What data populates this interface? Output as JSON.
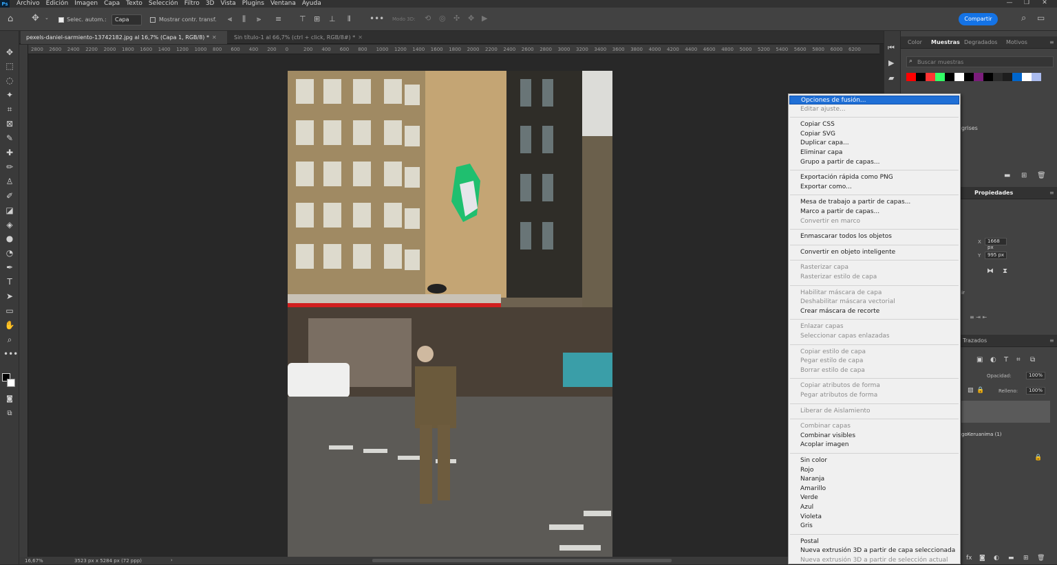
{
  "menubar": {
    "items": [
      "Archivo",
      "Edición",
      "Imagen",
      "Capa",
      "Texto",
      "Selección",
      "Filtro",
      "3D",
      "Vista",
      "Plugins",
      "Ventana",
      "Ayuda"
    ]
  },
  "options": {
    "auto_select_label": "Selec. autom.:",
    "layer_select": "Capa",
    "show_transform": "Mostrar contr. transf.",
    "mode3d": "Modo 3D:",
    "share": "Compartir"
  },
  "tabs": [
    {
      "label": "pexels-daniel-sarmiento-13742182.jpg al 16,7% (Capa 1, RGB/8) *"
    },
    {
      "label": "Sin título-1 al 66,7% (ctrl + click, RGB/8#) *"
    }
  ],
  "ruler_labels": [
    "2800",
    "2600",
    "2400",
    "2200",
    "2000",
    "1800",
    "1600",
    "1400",
    "1200",
    "1000",
    "800",
    "600",
    "400",
    "200",
    "0",
    "200",
    "400",
    "600",
    "800",
    "1000",
    "1200",
    "1400",
    "1600",
    "1800",
    "2000",
    "2200",
    "2400",
    "2600",
    "2800",
    "3000",
    "3200",
    "3400",
    "3600",
    "3800",
    "4000",
    "4200",
    "4400",
    "4600",
    "4800",
    "5000",
    "5200",
    "5400",
    "5600",
    "5800",
    "6000",
    "6200"
  ],
  "status": {
    "zoom": "16,67%",
    "dims": "3523 px x 5284 px (72 ppp)"
  },
  "panel": {
    "tabs": [
      "Color",
      "Muestras",
      "Degradados",
      "Motivos"
    ],
    "search_placeholder": "Buscar muestras",
    "swatch_colors": [
      "#ff0000",
      "#000000",
      "#ff3333",
      "#33ff66",
      "#000000",
      "#ffffff",
      "#000000",
      "#7b1d7b",
      "#000000",
      "#2b2b2b",
      "#1e1e1e",
      "#0066cc",
      "#ffffff",
      "#aabbee"
    ],
    "grises": "grises",
    "props_tab": "Propiedades",
    "x_label": "X",
    "x_value": "1668 px",
    "y_label": "Y",
    "y_value": "995 px",
    "ir": "ir",
    "trazados": "Trazados",
    "opacity_label": "Opacidad:",
    "opacity_value": "100%",
    "fill_label": "Relleno:",
    "fill_value": "100%",
    "layer_name": "goKeruanima (1)"
  },
  "context_menu": {
    "items": [
      {
        "label": "Opciones de fusión...",
        "state": "highlighted"
      },
      {
        "label": "Editar ajuste...",
        "state": "disabled"
      },
      {
        "label": "Copiar CSS",
        "state": "enabled"
      },
      {
        "label": "Copiar SVG",
        "state": "enabled"
      },
      {
        "label": "Duplicar capa...",
        "state": "enabled"
      },
      {
        "label": "Eliminar capa",
        "state": "enabled"
      },
      {
        "label": "Grupo a partir de capas...",
        "state": "enabled"
      },
      {
        "label": "Exportación rápida como PNG",
        "state": "enabled"
      },
      {
        "label": "Exportar como...",
        "state": "enabled"
      },
      {
        "label": "Mesa de trabajo a partir de capas...",
        "state": "enabled"
      },
      {
        "label": "Marco a partir de capas...",
        "state": "enabled"
      },
      {
        "label": "Convertir en marco",
        "state": "disabled"
      },
      {
        "label": "Enmascarar todos los objetos",
        "state": "enabled"
      },
      {
        "label": "Convertir en objeto inteligente",
        "state": "enabled"
      },
      {
        "label": "Rasterizar capa",
        "state": "disabled"
      },
      {
        "label": "Rasterizar estilo de capa",
        "state": "disabled"
      },
      {
        "label": "Habilitar máscara de capa",
        "state": "disabled"
      },
      {
        "label": "Deshabilitar máscara vectorial",
        "state": "disabled"
      },
      {
        "label": "Crear máscara de recorte",
        "state": "enabled"
      },
      {
        "label": "Enlazar capas",
        "state": "disabled"
      },
      {
        "label": "Seleccionar capas enlazadas",
        "state": "disabled"
      },
      {
        "label": "Copiar estilo de capa",
        "state": "disabled"
      },
      {
        "label": "Pegar estilo de capa",
        "state": "disabled"
      },
      {
        "label": "Borrar estilo de capa",
        "state": "disabled"
      },
      {
        "label": "Copiar atributos de forma",
        "state": "disabled"
      },
      {
        "label": "Pegar atributos de forma",
        "state": "disabled"
      },
      {
        "label": "Liberar de Aislamiento",
        "state": "disabled"
      },
      {
        "label": "Combinar capas",
        "state": "disabled"
      },
      {
        "label": "Combinar visibles",
        "state": "enabled"
      },
      {
        "label": "Acoplar imagen",
        "state": "enabled"
      },
      {
        "label": "Sin color",
        "state": "enabled"
      },
      {
        "label": "Rojo",
        "state": "enabled"
      },
      {
        "label": "Naranja",
        "state": "enabled"
      },
      {
        "label": "Amarillo",
        "state": "enabled"
      },
      {
        "label": "Verde",
        "state": "enabled"
      },
      {
        "label": "Azul",
        "state": "enabled"
      },
      {
        "label": "Violeta",
        "state": "enabled"
      },
      {
        "label": "Gris",
        "state": "enabled"
      },
      {
        "label": "Postal",
        "state": "enabled"
      },
      {
        "label": "Nueva extrusión 3D a partir de capa seleccionada",
        "state": "enabled"
      },
      {
        "label": "Nueva extrusión 3D a partir de selección actual",
        "state": "disabled"
      }
    ]
  }
}
